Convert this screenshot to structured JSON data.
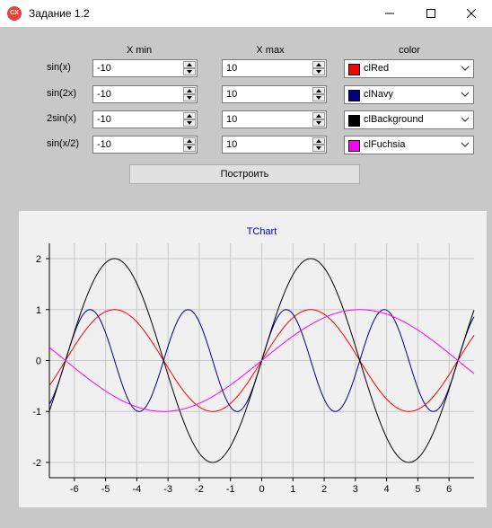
{
  "window": {
    "title": "Задание 1.2",
    "icon_label": "CX",
    "icons": [
      "minimize-icon",
      "maximize-icon",
      "close-icon"
    ]
  },
  "form": {
    "headers": {
      "xmin": "X min",
      "xmax": "X max",
      "color": "color"
    },
    "rows": [
      {
        "label": "sin(x)",
        "xmin": "-10",
        "xmax": "10",
        "color_name": "clRed",
        "color": "#ff0000"
      },
      {
        "label": "sin(2x)",
        "xmin": "-10",
        "xmax": "10",
        "color_name": "clNavy",
        "color": "#000080"
      },
      {
        "label": "2sin(x)",
        "xmin": "-10",
        "xmax": "10",
        "color_name": "clBackground",
        "color": "#000000"
      },
      {
        "label": "sin(x/2)",
        "xmin": "-10",
        "xmax": "10",
        "color_name": "clFuchsia",
        "color": "#ff00ff"
      }
    ],
    "build_button": "Построить"
  },
  "chart_data": {
    "type": "line",
    "title": "TChart",
    "xlim": [
      -6.8,
      6.8
    ],
    "ylim": [
      -2.3,
      2.3
    ],
    "x_ticks": [
      -6,
      -5,
      -4,
      -3,
      -2,
      -1,
      0,
      1,
      2,
      3,
      4,
      5,
      6
    ],
    "y_ticks": [
      -2,
      -1,
      0,
      1,
      2
    ],
    "grid": true,
    "series": [
      {
        "function": "sin(x)",
        "color": "#ff0000"
      },
      {
        "function": "sin(2x)",
        "color": "#000080"
      },
      {
        "function": "2sin(x)",
        "color": "#000000"
      },
      {
        "function": "sin(x/2)",
        "color": "#ff00ff"
      }
    ]
  }
}
